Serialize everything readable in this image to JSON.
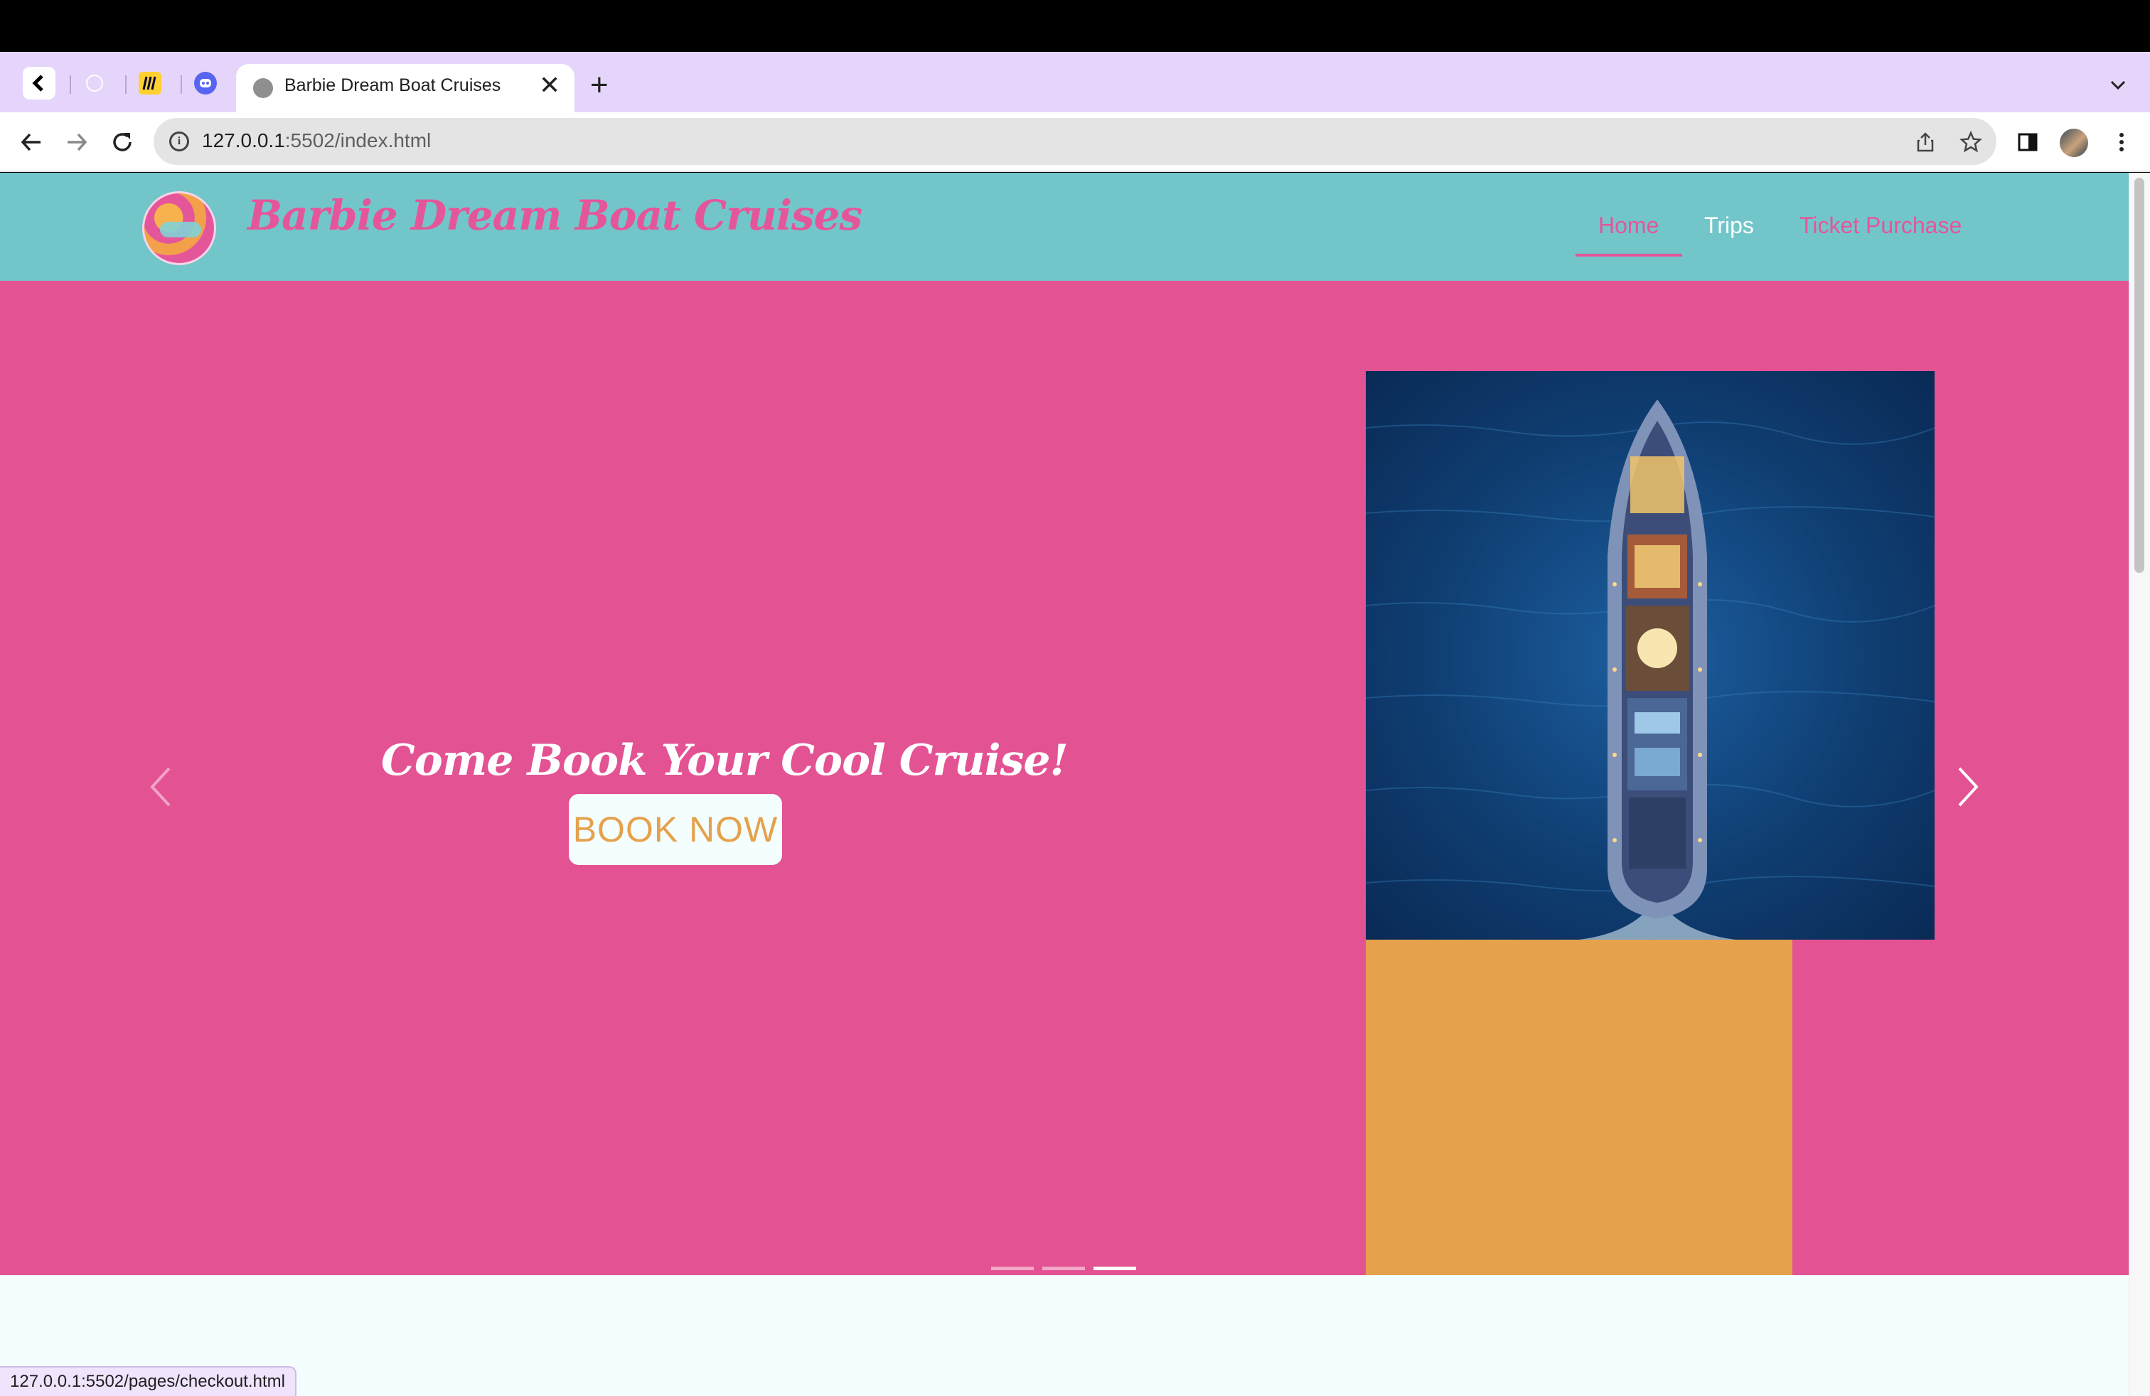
{
  "browser": {
    "active_tab_title": "Barbie Dream Boat Cruises",
    "new_tab_symbol": "+",
    "close_tab_symbol": "✕",
    "url_host": "127.0.0.1",
    "url_rest": ":5502/index.html",
    "status_url": "127.0.0.1:5502/pages/checkout.html",
    "pinned_tabs": [
      "back-chevron-icon",
      "circle-icon",
      "miro-icon",
      "discord-icon"
    ]
  },
  "site": {
    "title": "Barbie Dream Boat Cruises",
    "nav": [
      {
        "label": "Home",
        "active": true,
        "color": "#e5559a"
      },
      {
        "label": "Trips",
        "active": false,
        "color": "#ffffff"
      },
      {
        "label": "Ticket Purchase",
        "active": false,
        "color": "#e5559a"
      }
    ]
  },
  "hero": {
    "tagline": "Come Book Your Cool Cruise!",
    "button_label": "BOOK NOW",
    "indicators": [
      {
        "active": false
      },
      {
        "active": false
      },
      {
        "active": true
      }
    ]
  },
  "colors": {
    "header": "#72c6c9",
    "hero": "#e35293",
    "accent_pink": "#e5559a",
    "accent_orange": "#e5a14c",
    "tabstrip": "#e6d5fa"
  }
}
